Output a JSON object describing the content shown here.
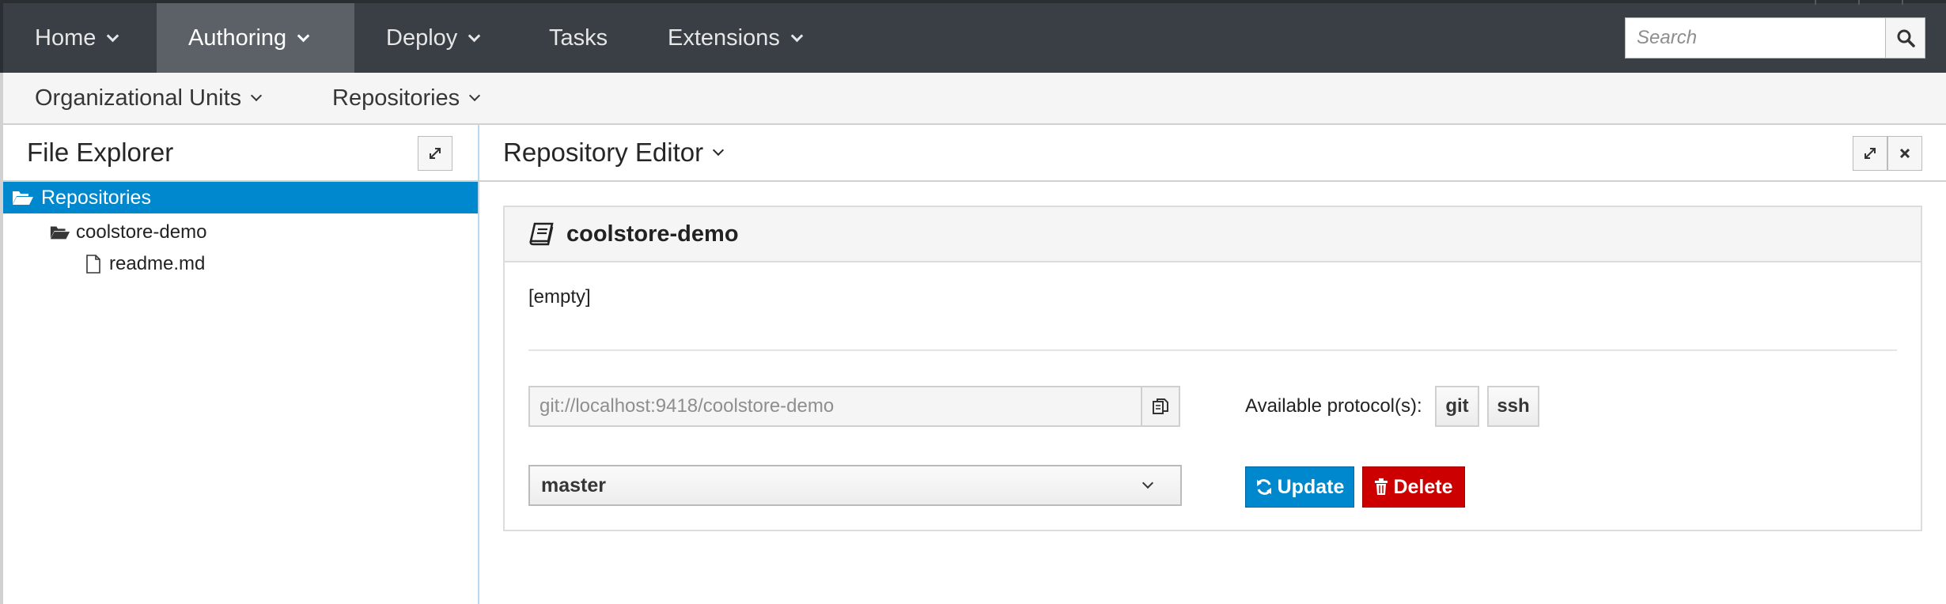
{
  "topnav": {
    "items": [
      {
        "label": "Home",
        "has_caret": true
      },
      {
        "label": "Authoring",
        "has_caret": true,
        "active": true
      },
      {
        "label": "Deploy",
        "has_caret": true
      },
      {
        "label": "Tasks",
        "has_caret": false
      },
      {
        "label": "Extensions",
        "has_caret": true
      }
    ],
    "search": {
      "placeholder": "Search",
      "value": "",
      "icon": "search-icon"
    }
  },
  "subnav": {
    "items": [
      {
        "label": "Organizational Units",
        "has_caret": true
      },
      {
        "label": "Repositories",
        "has_caret": true
      }
    ]
  },
  "file_explorer": {
    "title": "File Explorer",
    "expand_icon": "expand-icon",
    "tree": {
      "root": {
        "label": "Repositories",
        "icon": "folder-open-icon",
        "selected": true
      },
      "children": [
        {
          "label": "coolstore-demo",
          "icon": "folder-open-icon"
        },
        {
          "label": "readme.md",
          "icon": "file-icon"
        }
      ]
    }
  },
  "repository_editor": {
    "title": "Repository Editor",
    "expand_icon": "expand-icon",
    "close_icon": "close-icon",
    "repo": {
      "name": "coolstore-demo",
      "icon": "book-icon",
      "description": "[empty]",
      "clone_url": "git://localhost:9418/coolstore-demo",
      "copy_icon": "copy-icon",
      "protocols_label": "Available protocol(s):",
      "protocols": [
        "git",
        "ssh"
      ],
      "branch": "master",
      "update_label": "Update",
      "delete_label": "Delete"
    }
  },
  "colors": {
    "topbar": "#393f44",
    "active_nav": "#5b6166",
    "selection": "#0088ce",
    "primary": "#0088ce",
    "danger": "#cc0000"
  }
}
